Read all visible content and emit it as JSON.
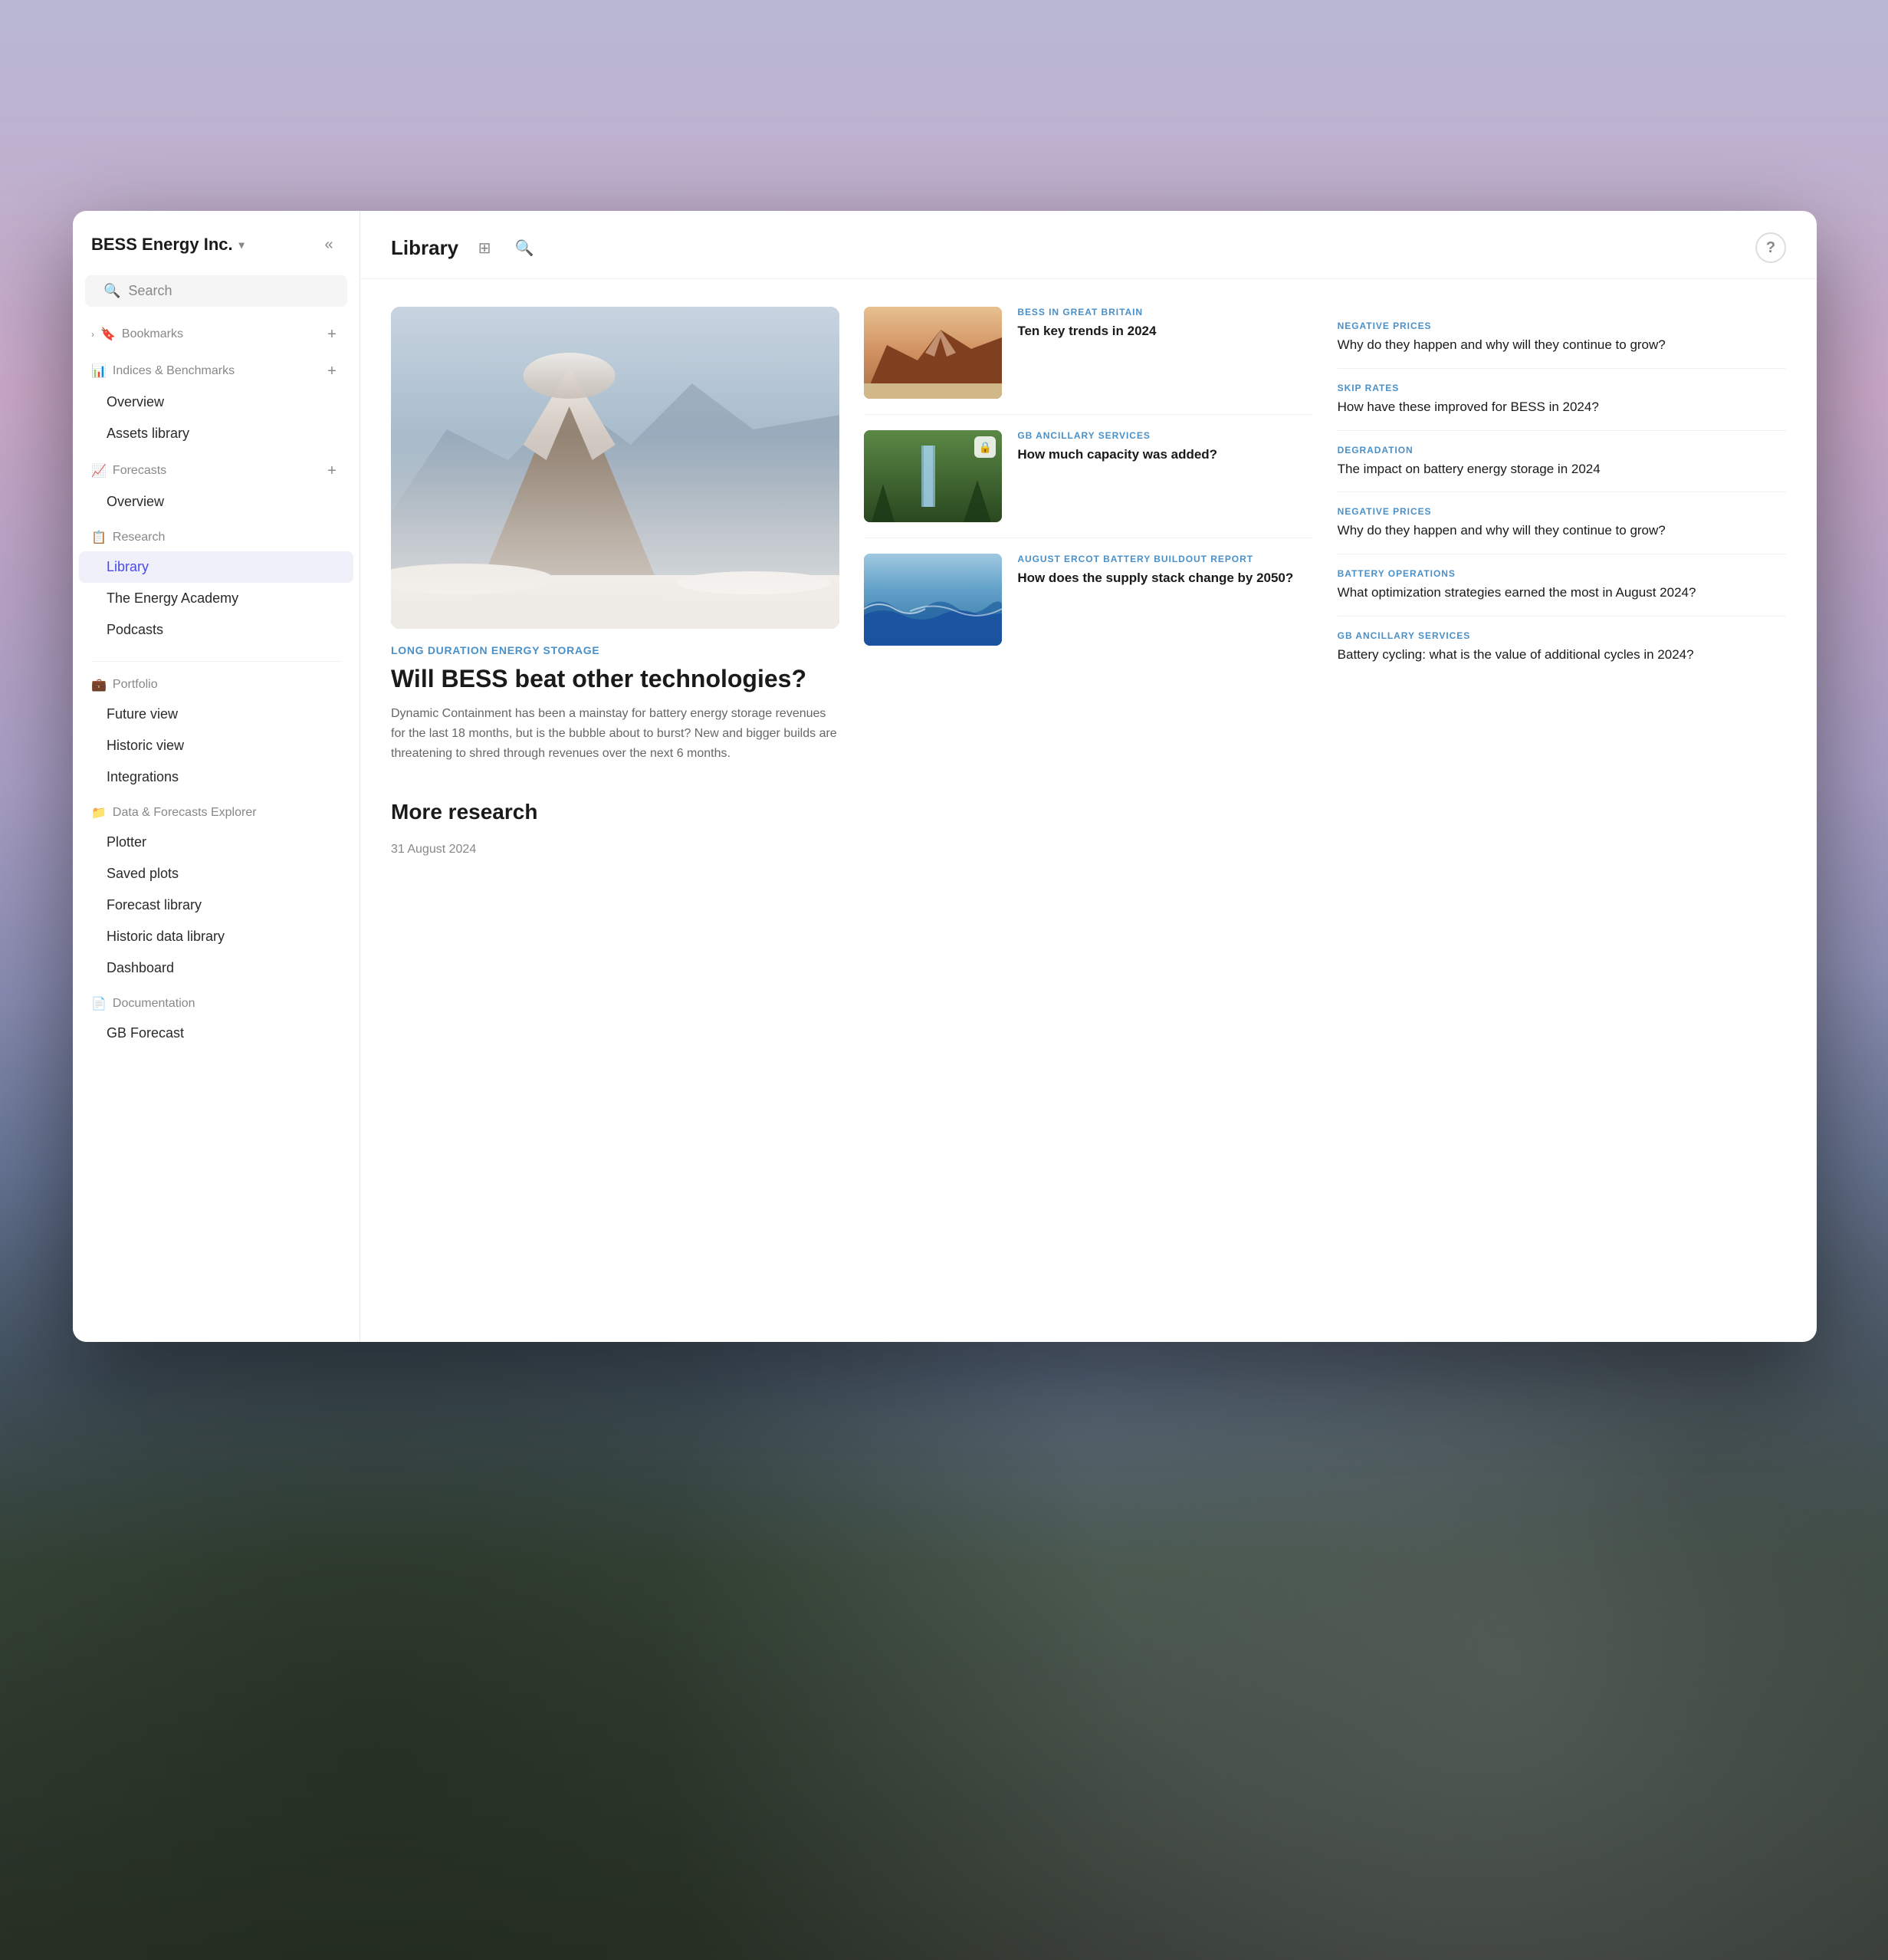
{
  "background": {
    "description": "Mountain winter landscape with purple-pink sky"
  },
  "sidebar": {
    "brand": "BESS Energy Inc.",
    "brand_chevron": "▾",
    "search_label": "Search",
    "collapse_icon": "«",
    "sections": [
      {
        "id": "bookmarks",
        "icon": "🔖",
        "label": "Bookmarks",
        "has_add": true,
        "items": []
      },
      {
        "id": "indices",
        "icon": "📊",
        "label": "Indices & Benchmarks",
        "has_add": true,
        "items": [
          {
            "label": "Overview",
            "active": false
          },
          {
            "label": "Assets library",
            "active": false
          }
        ]
      },
      {
        "id": "forecasts",
        "icon": "📈",
        "label": "Forecasts",
        "has_add": true,
        "items": [
          {
            "label": "Overview",
            "active": false
          }
        ]
      },
      {
        "id": "research",
        "icon": "📋",
        "label": "Research",
        "has_add": false,
        "items": [
          {
            "label": "Library",
            "active": true
          },
          {
            "label": "The Energy Academy",
            "active": false
          },
          {
            "label": "Podcasts",
            "active": false
          }
        ]
      },
      {
        "id": "portfolio",
        "icon": "💼",
        "label": "Portfolio",
        "has_add": false,
        "items": [
          {
            "label": "Future view",
            "active": false
          },
          {
            "label": "Historic view",
            "active": false
          },
          {
            "label": "Integrations",
            "active": false
          }
        ]
      },
      {
        "id": "data-forecasts",
        "icon": "📁",
        "label": "Data & Forecasts Explorer",
        "has_add": false,
        "items": [
          {
            "label": "Plotter",
            "active": false
          },
          {
            "label": "Saved plots",
            "active": false
          },
          {
            "label": "Forecast library",
            "active": false
          },
          {
            "label": "Historic data library",
            "active": false
          },
          {
            "label": "Dashboard",
            "active": false
          }
        ]
      },
      {
        "id": "documentation",
        "icon": "📄",
        "label": "Documentation",
        "has_add": false,
        "items": [
          {
            "label": "GB Forecast",
            "active": false
          }
        ]
      }
    ]
  },
  "main": {
    "title": "Library",
    "filter_icon": "▼",
    "search_icon": "🔍",
    "help_icon": "?",
    "featured_article": {
      "category": "LONG DURATION ENERGY STORAGE",
      "headline": "Will BESS beat other technologies?",
      "description": "Dynamic Containment has been a mainstay for battery energy storage revenues for the last 18 months, but is the bubble about to burst? New and bigger builds are threatening to shred through revenues over the next 6 months."
    },
    "middle_articles": [
      {
        "id": "art-1",
        "category": "BESS IN GREAT BRITAIN",
        "title": "Ten key trends in 2024",
        "thumb_style": "mountain-red"
      },
      {
        "id": "art-2",
        "category": "GB ANCILLARY SERVICES",
        "title": "How much capacity was added?",
        "thumb_style": "forest-waterfall",
        "locked": true
      },
      {
        "id": "art-3",
        "category": "AUGUST ERCOT BATTERY BUILDOUT REPORT",
        "title": "How does the supply stack change by 2050?",
        "thumb_style": "ocean-waves"
      }
    ],
    "right_articles": [
      {
        "id": "ra-1",
        "category": "NEGATIVE PRICES",
        "title": "Why do they happen and why will they continue to grow?"
      },
      {
        "id": "ra-2",
        "category": "SKIP RATES",
        "title": "How have these improved for BESS in 2024?"
      },
      {
        "id": "ra-3",
        "category": "DEGRADATION",
        "title": "The impact on battery energy storage in 2024"
      },
      {
        "id": "ra-4",
        "category": "NEGATIVE PRICES",
        "title": "Why do they happen and why will they continue to grow?"
      },
      {
        "id": "ra-5",
        "category": "BATTERY OPERATIONS",
        "title": "What optimization strategies earned the most in August 2024?"
      },
      {
        "id": "ra-6",
        "category": "GB ANCILLARY SERVICES",
        "title": "Battery cycling: what is the value of additional cycles in 2024?"
      }
    ],
    "more_research_label": "More research",
    "more_research_date": "31 August 2024"
  }
}
